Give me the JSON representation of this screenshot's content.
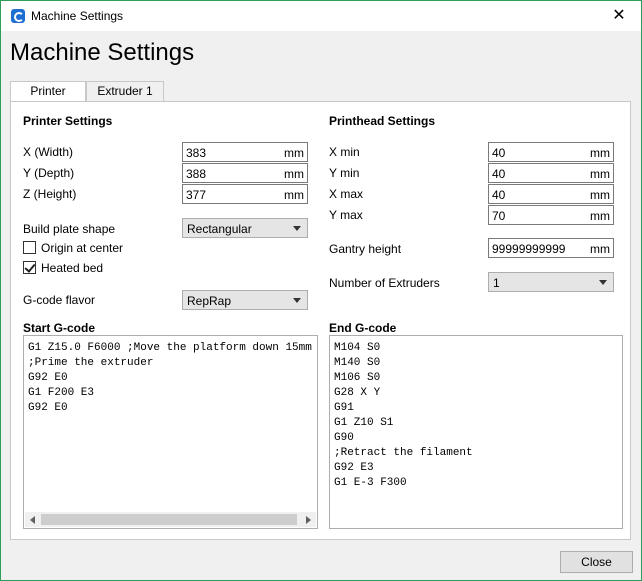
{
  "window": {
    "title": "Machine Settings",
    "close_glyph": "✕"
  },
  "heading": "Machine Settings",
  "tabs": [
    {
      "label": "Printer",
      "active": true
    },
    {
      "label": "Extruder 1",
      "active": false
    }
  ],
  "printer": {
    "section_title": "Printer Settings",
    "x_label": "X (Width)",
    "x_value": "383",
    "x_unit": "mm",
    "y_label": "Y (Depth)",
    "y_value": "388",
    "y_unit": "mm",
    "z_label": "Z (Height)",
    "z_value": "377",
    "z_unit": "mm",
    "build_plate_label": "Build plate shape",
    "build_plate_value": "Rectangular",
    "origin_label": "Origin at center",
    "origin_checked": false,
    "heated_label": "Heated bed",
    "heated_checked": true,
    "gcode_flavor_label": "G-code flavor",
    "gcode_flavor_value": "RepRap"
  },
  "printhead": {
    "section_title": "Printhead Settings",
    "xmin_label": "X min",
    "xmin_value": "40",
    "xmin_unit": "mm",
    "ymin_label": "Y min",
    "ymin_value": "40",
    "ymin_unit": "mm",
    "xmax_label": "X max",
    "xmax_value": "40",
    "xmax_unit": "mm",
    "ymax_label": "Y max",
    "ymax_value": "70",
    "ymax_unit": "mm",
    "gantry_label": "Gantry height",
    "gantry_value": "99999999999",
    "gantry_unit": "mm",
    "extruders_label": "Number of Extruders",
    "extruders_value": "1"
  },
  "start_gcode": {
    "title": "Start G-code",
    "text": "G1 Z15.0 F6000 ;Move the platform down 15mm\n;Prime the extruder\nG92 E0\nG1 F200 E3\nG92 E0"
  },
  "end_gcode": {
    "title": "End G-code",
    "text": "M104 S0\nM140 S0\nM106 S0\nG28 X Y\nG91\nG1 Z10 S1\nG90\n;Retract the filament\nG92 E3\nG1 E-3 F300"
  },
  "footer": {
    "close_label": "Close"
  }
}
